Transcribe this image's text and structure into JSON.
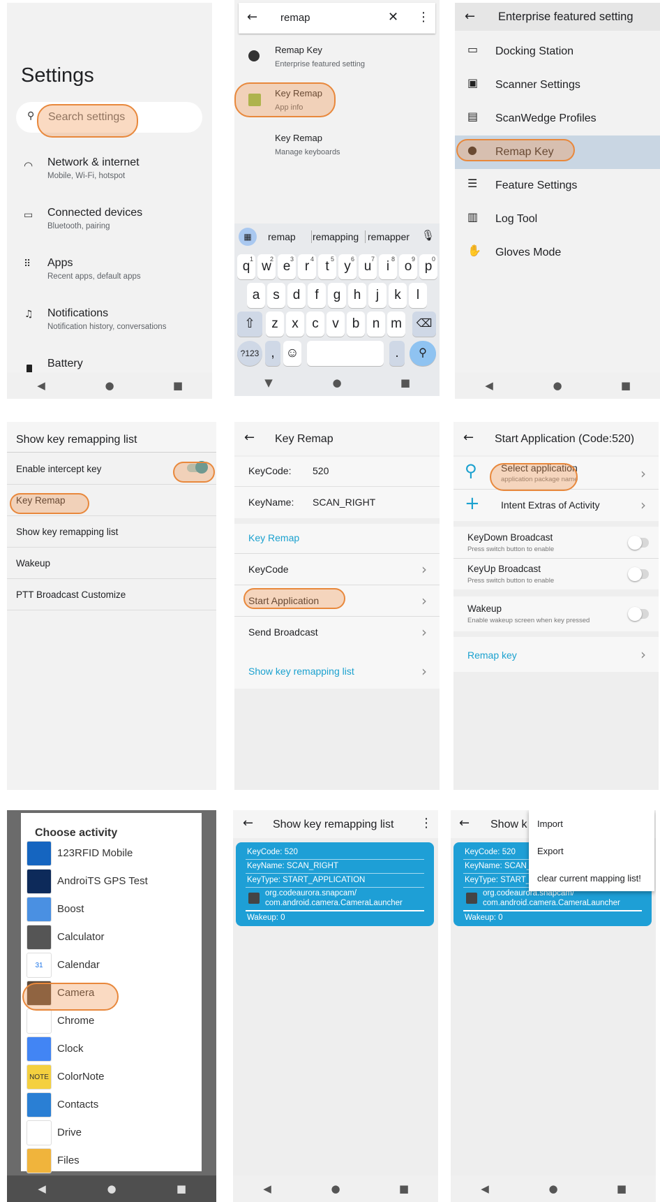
{
  "p1": {
    "title": "Settings",
    "search_placeholder": "Search settings",
    "items": [
      {
        "title": "Network & internet",
        "sub": "Mobile, Wi-Fi, hotspot",
        "icon": "wifi-icon"
      },
      {
        "title": "Connected devices",
        "sub": "Bluetooth, pairing",
        "icon": "devices-icon"
      },
      {
        "title": "Apps",
        "sub": "Recent apps, default apps",
        "icon": "apps-grid-icon"
      },
      {
        "title": "Notifications",
        "sub": "Notification history, conversations",
        "icon": "bell-icon"
      },
      {
        "title": "Battery",
        "sub": "",
        "icon": "battery-icon"
      }
    ]
  },
  "p2": {
    "query": "remap",
    "results": [
      {
        "title": "Remap Key",
        "sub": "Enterprise featured setting"
      },
      {
        "title": "Key Remap",
        "sub": "App info"
      },
      {
        "title": "Key Remap",
        "sub": "Manage keyboards"
      }
    ],
    "suggestions": [
      "remap",
      "remapping",
      "remapper"
    ],
    "row1": [
      [
        "q",
        "1"
      ],
      [
        "w",
        "2"
      ],
      [
        "e",
        "3"
      ],
      [
        "r",
        "4"
      ],
      [
        "t",
        "5"
      ],
      [
        "y",
        "6"
      ],
      [
        "u",
        "7"
      ],
      [
        "i",
        "8"
      ],
      [
        "o",
        "9"
      ],
      [
        "p",
        "0"
      ]
    ],
    "row2": [
      "a",
      "s",
      "d",
      "f",
      "g",
      "h",
      "j",
      "k",
      "l"
    ],
    "row3": [
      "z",
      "x",
      "c",
      "v",
      "b",
      "n",
      "m"
    ],
    "sym_key": "?123",
    "comma": ",",
    "period": "."
  },
  "p3": {
    "title": "Enterprise featured setting",
    "items": [
      {
        "label": "Docking Station",
        "icon": "dock-icon"
      },
      {
        "label": "Scanner Settings",
        "icon": "scanner-icon"
      },
      {
        "label": "ScanWedge Profiles",
        "icon": "profile-icon"
      },
      {
        "label": "Remap Key",
        "icon": "globe-icon"
      },
      {
        "label": "Feature Settings",
        "icon": "feature-icon"
      },
      {
        "label": "Log Tool",
        "icon": "clipboard-icon"
      },
      {
        "label": "Gloves Mode",
        "icon": "glove-icon"
      }
    ]
  },
  "p4": {
    "title": "Show key remapping list",
    "items": [
      "Enable intercept key",
      "Key Remap",
      "Show key remapping list",
      "Wakeup",
      "PTT Broadcast Customize"
    ]
  },
  "p5": {
    "title": "Key Remap",
    "keycode_label": "KeyCode:",
    "keycode_value": "520",
    "keyname_label": "KeyName:",
    "keyname_value": "SCAN_RIGHT",
    "section": "Key Remap",
    "items": [
      "KeyCode",
      "Start Application",
      "Send Broadcast"
    ],
    "footer": "Show key remapping list"
  },
  "p6": {
    "title": "Start Application (Code:520)",
    "select_title": "Select application",
    "select_sub": "application package name",
    "intent": "Intent Extras of Activity",
    "toggles": [
      {
        "title": "KeyDown Broadcast",
        "sub": "Press switch button to enable"
      },
      {
        "title": "KeyUp Broadcast",
        "sub": "Press switch button to enable"
      },
      {
        "title": "Wakeup",
        "sub": "Enable wakeup screen when key pressed"
      }
    ],
    "remap": "Remap key"
  },
  "p7": {
    "title": "Choose activity",
    "apps": [
      "123RFID Mobile",
      "AndroiTS GPS Test",
      "Boost",
      "Calculator",
      "Calendar",
      "Camera",
      "Chrome",
      "Clock",
      "ColorNote",
      "Contacts",
      "Drive",
      "Files"
    ],
    "calendar_num": "31",
    "colornote_tag": "NOTE"
  },
  "p8": {
    "title": "Show key remapping list",
    "card": {
      "keycode": "KeyCode: 520",
      "keyname": "KeyName: SCAN_RIGHT",
      "keytype": "KeyType: START_APPLICATION",
      "activity1": "org.codeaurora.snapcam/",
      "activity2": "com.android.camera.CameraLauncher",
      "wakeup": "Wakeup: 0"
    }
  },
  "p9": {
    "title_partial": "Show k",
    "card": {
      "keycode": "KeyCode: 520",
      "keyname": "KeyName: SCAN_",
      "keytype": "KeyType: START_",
      "activity1": "org.codeaurora.snapcam/",
      "activity2": "com.android.camera.CameraLauncher",
      "wakeup": "Wakeup: 0"
    },
    "menu": [
      "Import",
      "Export",
      "clear current mapping list!"
    ]
  },
  "colors": {
    "accent": "#1e9fd6",
    "highlight": "#e8883c",
    "selected_row": "#c9d6e3",
    "link": "#1ba1cf"
  }
}
